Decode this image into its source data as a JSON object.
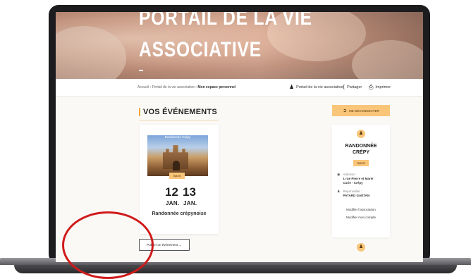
{
  "hero": {
    "title_line1": "PORTAIL DE LA VIE",
    "title_line2": "ASSOCIATIVE"
  },
  "breadcrumb": {
    "home": "Accueil",
    "sep": "›",
    "parent": "Portail de la vie associative",
    "current": "Mon espace personnel"
  },
  "toolbar": {
    "portal_label": "Portail de la vie associative",
    "share_label": "Partager",
    "print_label": "Imprimer"
  },
  "events": {
    "section_title": "VOS ÉVÉNEMENTS",
    "card": {
      "image_caption": "Randonnée Crépy",
      "category": "Sport",
      "day_start": "12",
      "day_end": "13",
      "month_start": "JAN.",
      "month_end": "JAN.",
      "name": "Randonnée crépynoise"
    },
    "publish_button": "Publier un événement →"
  },
  "sidebar": {
    "logout_button": "ME DÉCONNECTER",
    "association": {
      "name_line1": "RANDONNÉE",
      "name_line2": "CRÉPY",
      "category": "Sport",
      "address_label": "Adresse :",
      "address_line1": "1 rue Pierre et Marie",
      "address_line2": "Curie - Crépy",
      "manager_label": "Reponsable :",
      "manager_value": "PATARD GAËTAN",
      "edit_association": "Modifier l'association",
      "edit_account": "Modifier mon compte"
    }
  },
  "colors": {
    "accent": "#f9c679",
    "accent_border": "#f1a93a",
    "annotation_circle": "#cf1b1b"
  }
}
